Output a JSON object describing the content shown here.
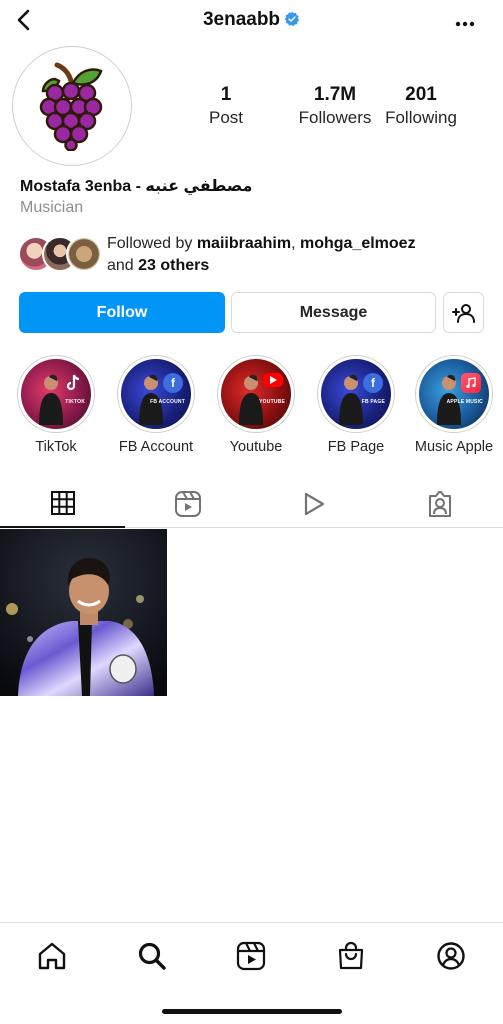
{
  "header": {
    "username": "3enaabb",
    "verified_color": "#3897f0"
  },
  "profile": {
    "avatar_icon": "grapes-icon",
    "stats": {
      "posts_count": "1",
      "posts_label": "Post",
      "followers_count": "1.7M",
      "followers_label": "Followers",
      "following_count": "201",
      "following_label": "Following"
    },
    "display_name": "Mostafa 3enba - مصطفي عنبه",
    "category": "Musician"
  },
  "followed_by": {
    "prefix": "Followed by ",
    "user1": "maiibraahim",
    "separator": ", ",
    "user2": "mohga_elmoez",
    "and_text": "and ",
    "others": "23 others"
  },
  "actions": {
    "follow_label": "Follow",
    "message_label": "Message",
    "follow_color": "#0095f6"
  },
  "highlights": [
    {
      "label": "TikTok",
      "caption": "TIKTOK"
    },
    {
      "label": "FB Account",
      "caption": "FB ACCOUNT"
    },
    {
      "label": "Youtube",
      "caption": "YOUTUBE"
    },
    {
      "label": "FB Page",
      "caption": "FB PAGE"
    },
    {
      "label": "Music Apple",
      "caption": "APPLE MUSIC"
    }
  ],
  "tabs": [
    "grid-icon",
    "reels-icon",
    "play-icon",
    "tagged-icon"
  ],
  "bottom_nav": [
    "home-icon",
    "search-icon",
    "reels-icon",
    "shop-icon",
    "profile-icon"
  ]
}
